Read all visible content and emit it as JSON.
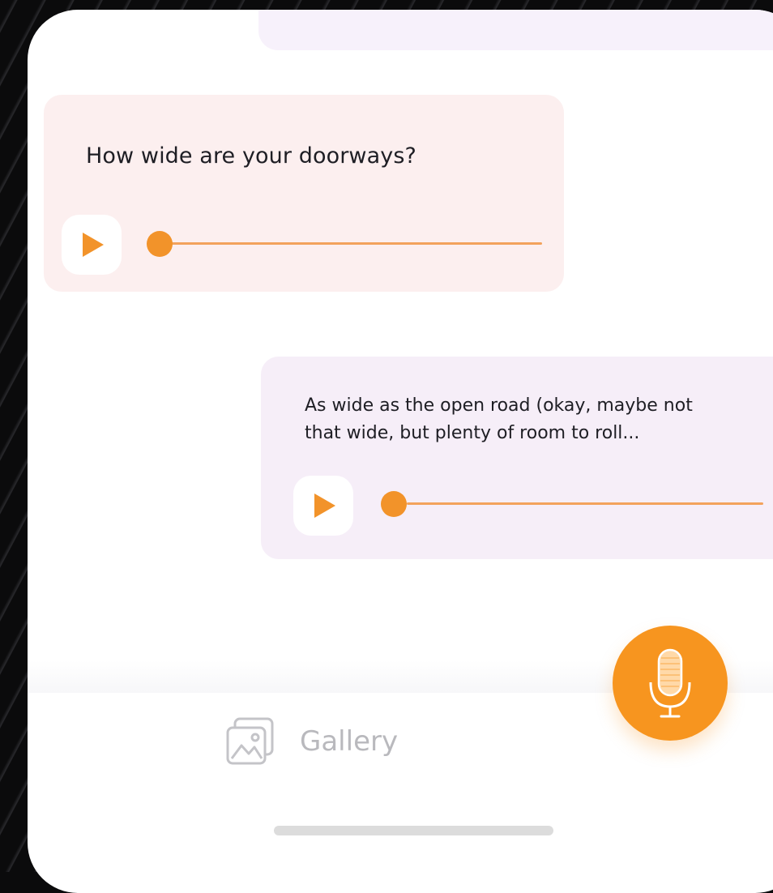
{
  "chat": {
    "incoming": {
      "text": "How wide are your doorways?",
      "progress": 0
    },
    "outgoing": {
      "line1": "As wide as the open road (okay, maybe not",
      "line2": "that wide, but plenty of room to roll...",
      "progress": 0
    }
  },
  "bottom_bar": {
    "gallery_label": "Gallery"
  },
  "icons": {
    "play": "play-icon",
    "gallery": "image-gallery-icon",
    "mic": "microphone-icon"
  },
  "colors": {
    "accent": "#f7951f",
    "incoming_bubble": "#fcefef",
    "outgoing_bubble": "#f6eef8"
  }
}
